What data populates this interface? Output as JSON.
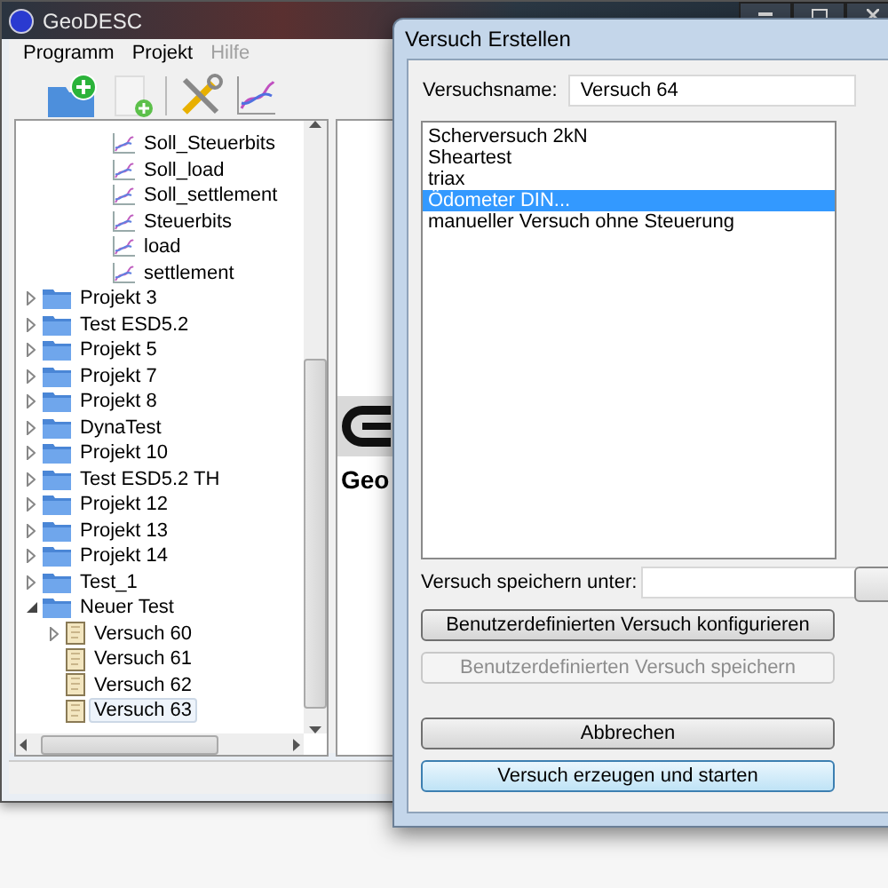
{
  "window": {
    "title": "GeoDESC"
  },
  "menu": [
    {
      "label": "Programm",
      "disabled": false
    },
    {
      "label": "Projekt",
      "disabled": false
    },
    {
      "label": "Hilfe",
      "disabled": true
    }
  ],
  "tree": {
    "clipped_children": [
      {
        "label": "Soll_Steuerbits"
      },
      {
        "label": "Soll_load"
      },
      {
        "label": "Soll_settlement"
      },
      {
        "label": "Steuerbits"
      },
      {
        "label": "load"
      },
      {
        "label": "settlement"
      }
    ],
    "items": [
      {
        "label": "Projekt 3",
        "expanded": false
      },
      {
        "label": "Test ESD5.2",
        "expanded": false
      },
      {
        "label": "Projekt 5",
        "expanded": false
      },
      {
        "label": "Projekt 7",
        "expanded": false
      },
      {
        "label": "Projekt 8",
        "expanded": false
      },
      {
        "label": "DynaTest",
        "expanded": false
      },
      {
        "label": "Projekt 10",
        "expanded": false
      },
      {
        "label": "Test ESD5.2 TH",
        "expanded": false
      },
      {
        "label": "Projekt 12",
        "expanded": false
      },
      {
        "label": "Projekt 13",
        "expanded": false
      },
      {
        "label": "Projekt 14",
        "expanded": false
      },
      {
        "label": "Test_1",
        "expanded": false
      },
      {
        "label": "Neuer Test",
        "expanded": true,
        "children": [
          {
            "label": "Versuch 60",
            "expandable": true,
            "selected": false
          },
          {
            "label": "Versuch 61",
            "expandable": false,
            "selected": false
          },
          {
            "label": "Versuch 62",
            "expandable": false,
            "selected": false
          },
          {
            "label": "Versuch 63",
            "expandable": false,
            "selected": true
          }
        ]
      }
    ]
  },
  "logo": {
    "text": "Geo"
  },
  "dialog": {
    "title": "Versuch Erstellen",
    "name_label": "Versuchsname:",
    "name_value": "Versuch 64",
    "list": [
      {
        "label": "Scherversuch 2kN",
        "selected": false
      },
      {
        "label": "Sheartest",
        "selected": false
      },
      {
        "label": "triax",
        "selected": false
      },
      {
        "label": "Ödometer DIN...",
        "selected": true
      },
      {
        "label": "manueller Versuch ohne Steuerung",
        "selected": false
      }
    ],
    "save_label": "Versuch speichern unter:",
    "custom_buttons": [
      {
        "label": "Benutzerdefinierten Versuch  konfigurieren",
        "disabled": false,
        "default": false
      },
      {
        "label": "Benutzerdefinierten Versuch speichern",
        "disabled": true,
        "default": false
      }
    ],
    "action_buttons": [
      {
        "label": "Abbrechen",
        "disabled": false,
        "default": false
      },
      {
        "label": "Versuch erzeugen und starten",
        "disabled": false,
        "default": true
      }
    ]
  }
}
